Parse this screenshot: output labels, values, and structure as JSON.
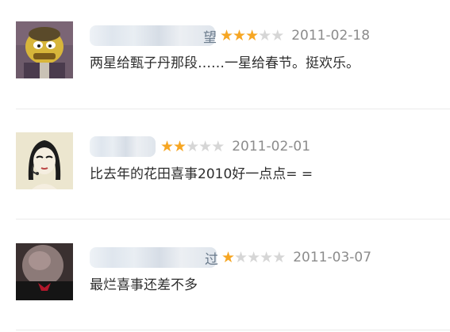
{
  "comments": [
    {
      "user_suffix": "望",
      "rating": 3,
      "max_rating": 5,
      "date": "2011-02-18",
      "text": "两星给甄子丹那段……一星给春节。挺欢乐。",
      "avatar_icon": "bald-cartoon-man-avatar"
    },
    {
      "user_suffix": "",
      "rating": 2,
      "max_rating": 5,
      "date": "2011-02-01",
      "text": "比去年的花田喜事2010好一点点= =",
      "avatar_icon": "cartoon-girl-headset-avatar"
    },
    {
      "user_suffix": "过",
      "rating": 1,
      "max_rating": 5,
      "date": "2011-03-07",
      "text": "最烂喜事还差不多",
      "avatar_icon": "blurred-photo-avatar"
    }
  ],
  "colors": {
    "star_on": "#f6a623",
    "star_off": "#d6d6d6",
    "date": "#8c8c8c"
  }
}
